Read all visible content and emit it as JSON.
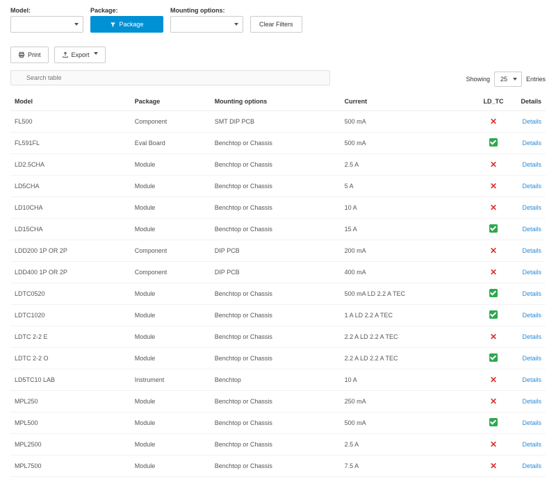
{
  "filters": {
    "model_label": "Model:",
    "package_label": "Package:",
    "mounting_label": "Mounting options:",
    "package_btn": "Package",
    "clear": "Clear Filters"
  },
  "toolbar": {
    "print": "Print",
    "export": "Export"
  },
  "search": {
    "placeholder": "Search table"
  },
  "paging": {
    "showing": "Showing",
    "count": "25",
    "entries": "Entries"
  },
  "columns": {
    "model": "Model",
    "package": "Package",
    "mounting": "Mounting options",
    "current": "Current",
    "ldtc": "LD_TC",
    "details": "Details"
  },
  "details_label": "Details",
  "rows": [
    {
      "model": "FL500",
      "package": "Component",
      "mounting": "SMT DIP PCB",
      "current": "500 mA",
      "ldtc": "x"
    },
    {
      "model": "FL591FL",
      "package": "Eval Board",
      "mounting": "Benchtop or Chassis",
      "current": "500 mA",
      "ldtc": "check"
    },
    {
      "model": "LD2.5CHA",
      "package": "Module",
      "mounting": "Benchtop or Chassis",
      "current": "2.5 A",
      "ldtc": "x"
    },
    {
      "model": "LD5CHA",
      "package": "Module",
      "mounting": "Benchtop or Chassis",
      "current": "5 A",
      "ldtc": "x"
    },
    {
      "model": "LD10CHA",
      "package": "Module",
      "mounting": "Benchtop or Chassis",
      "current": "10 A",
      "ldtc": "x"
    },
    {
      "model": "LD15CHA",
      "package": "Module",
      "mounting": "Benchtop or Chassis",
      "current": "15 A",
      "ldtc": "check"
    },
    {
      "model": "LDD200 1P OR 2P",
      "package": "Component",
      "mounting": "DIP PCB",
      "current": "200 mA",
      "ldtc": "x"
    },
    {
      "model": "LDD400 1P OR 2P",
      "package": "Component",
      "mounting": "DIP PCB",
      "current": "400 mA",
      "ldtc": "x"
    },
    {
      "model": "LDTC0520",
      "package": "Module",
      "mounting": "Benchtop or Chassis",
      "current": "500 mA LD  2.2 A TEC",
      "ldtc": "check"
    },
    {
      "model": "LDTC1020",
      "package": "Module",
      "mounting": "Benchtop or Chassis",
      "current": "1 A LD  2.2 A TEC",
      "ldtc": "check"
    },
    {
      "model": "LDTC 2-2 E",
      "package": "Module",
      "mounting": "Benchtop or Chassis",
      "current": "2.2 A LD  2.2 A TEC",
      "ldtc": "x"
    },
    {
      "model": "LDTC 2-2 O",
      "package": "Module",
      "mounting": "Benchtop or Chassis",
      "current": "2.2 A LD  2.2 A TEC",
      "ldtc": "check"
    },
    {
      "model": "LD5TC10 LAB",
      "package": "Instrument",
      "mounting": "Benchtop",
      "current": "10 A",
      "ldtc": "x"
    },
    {
      "model": "MPL250",
      "package": "Module",
      "mounting": "Benchtop or Chassis",
      "current": "250 mA",
      "ldtc": "x"
    },
    {
      "model": "MPL500",
      "package": "Module",
      "mounting": "Benchtop or Chassis",
      "current": "500 mA",
      "ldtc": "check"
    },
    {
      "model": "MPL2500",
      "package": "Module",
      "mounting": "Benchtop or Chassis",
      "current": "2.5 A",
      "ldtc": "x"
    },
    {
      "model": "MPL7500",
      "package": "Module",
      "mounting": "Benchtop or Chassis",
      "current": "7.5 A",
      "ldtc": "x"
    }
  ]
}
